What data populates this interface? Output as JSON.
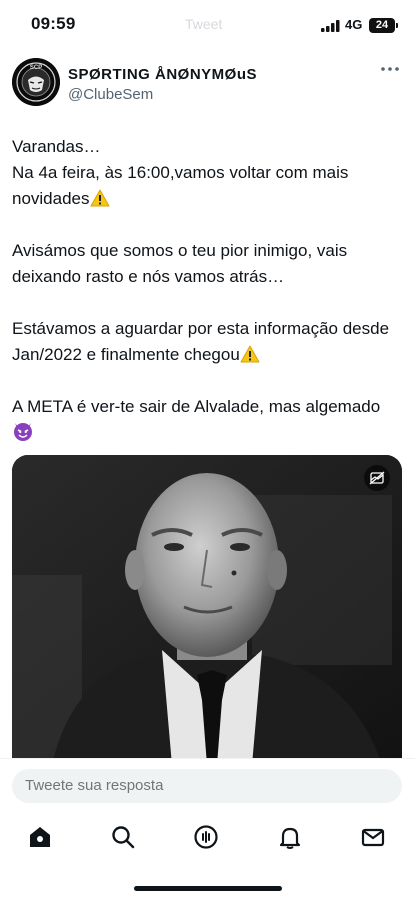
{
  "status_bar": {
    "time": "09:59",
    "faded_text": "Tweet",
    "network": "4G",
    "battery": "24"
  },
  "author": {
    "display_name": "SPØRTING ÅNØNYMØuS",
    "handle": "@ClubeSem",
    "avatar_text": "SCP"
  },
  "tweet": {
    "paragraphs": [
      "Varandas…\nNa 4a feira, às 16:00,vamos voltar com mais novidades",
      "Avisámos que somos o teu pior inimigo, vais deixando rasto e nós vamos atrás…",
      "Estávamos a aguardar por esta informação desde Jan/2022 e finalmente chegou",
      "A META é ver-te sair de Alvalade, mas algemado"
    ]
  },
  "media": {
    "alt_icon": "media-options-icon"
  },
  "reply": {
    "placeholder": "Tweete sua resposta"
  },
  "tabbar": {
    "items": [
      "home-icon",
      "search-icon",
      "spaces-icon",
      "notifications-icon",
      "messages-icon"
    ]
  },
  "colors": {
    "text": "#0f1419",
    "secondary": "#536471",
    "input_bg": "#eff3f4",
    "emoji_warn": "#f5c518",
    "emoji_devil": "#8a3fbf"
  }
}
